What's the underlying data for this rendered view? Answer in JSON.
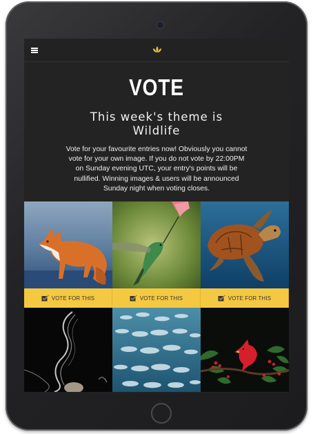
{
  "header": {
    "menu_icon": "hamburger-menu-icon",
    "logo_icon": "lotus-logo-icon",
    "accent": "#f5c842"
  },
  "page": {
    "title": "VOTE",
    "theme_heading": "This week's theme is Wildlife",
    "description": "Vote for your favourite entries now! Obviously you cannot vote for your own image. If you do not vote by 22:00PM on Sunday evening UTC, your entry's points will be nullified. Winning images & users will be announced Sunday night when voting closes."
  },
  "entries": [
    {
      "subject": "fox",
      "vote_label": "VOTE FOR THIS"
    },
    {
      "subject": "hummingbird",
      "vote_label": "VOTE FOR THIS"
    },
    {
      "subject": "sea-turtle",
      "vote_label": "VOTE FOR THIS"
    },
    {
      "subject": "abstract-smoke"
    },
    {
      "subject": "fish-school"
    },
    {
      "subject": "cardinal"
    }
  ]
}
